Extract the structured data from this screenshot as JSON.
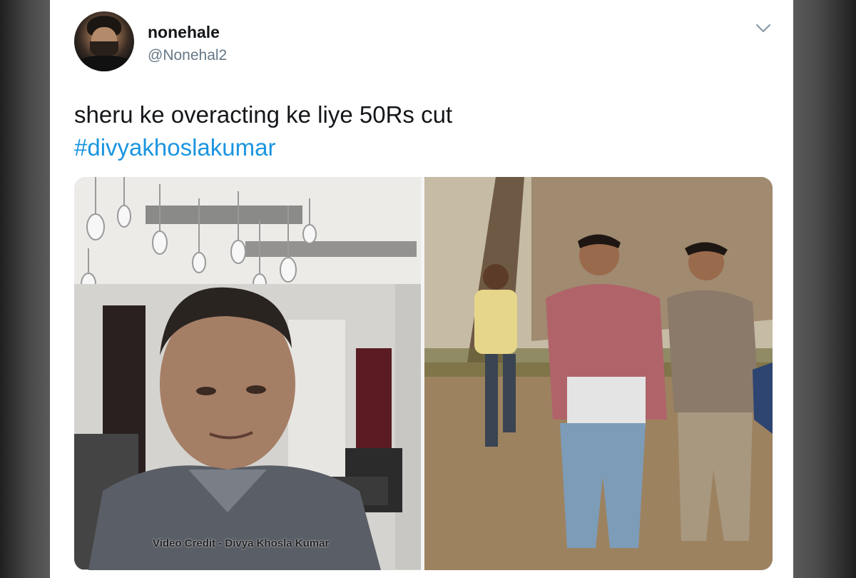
{
  "tweet": {
    "display_name": "nonehale",
    "handle": "@Nonehal2",
    "text": "sheru ke overacting ke liye 50Rs cut",
    "hashtag": "#divyakhoslakumar",
    "menu_icon": "chevron-down-icon",
    "avatar_icon": "profile-avatar"
  },
  "media": {
    "left_panel_caption": "Video Credit - Divya Khosla Kumar"
  },
  "colors": {
    "link": "#1b95e0",
    "text": "#14171a",
    "secondary": "#657786"
  }
}
